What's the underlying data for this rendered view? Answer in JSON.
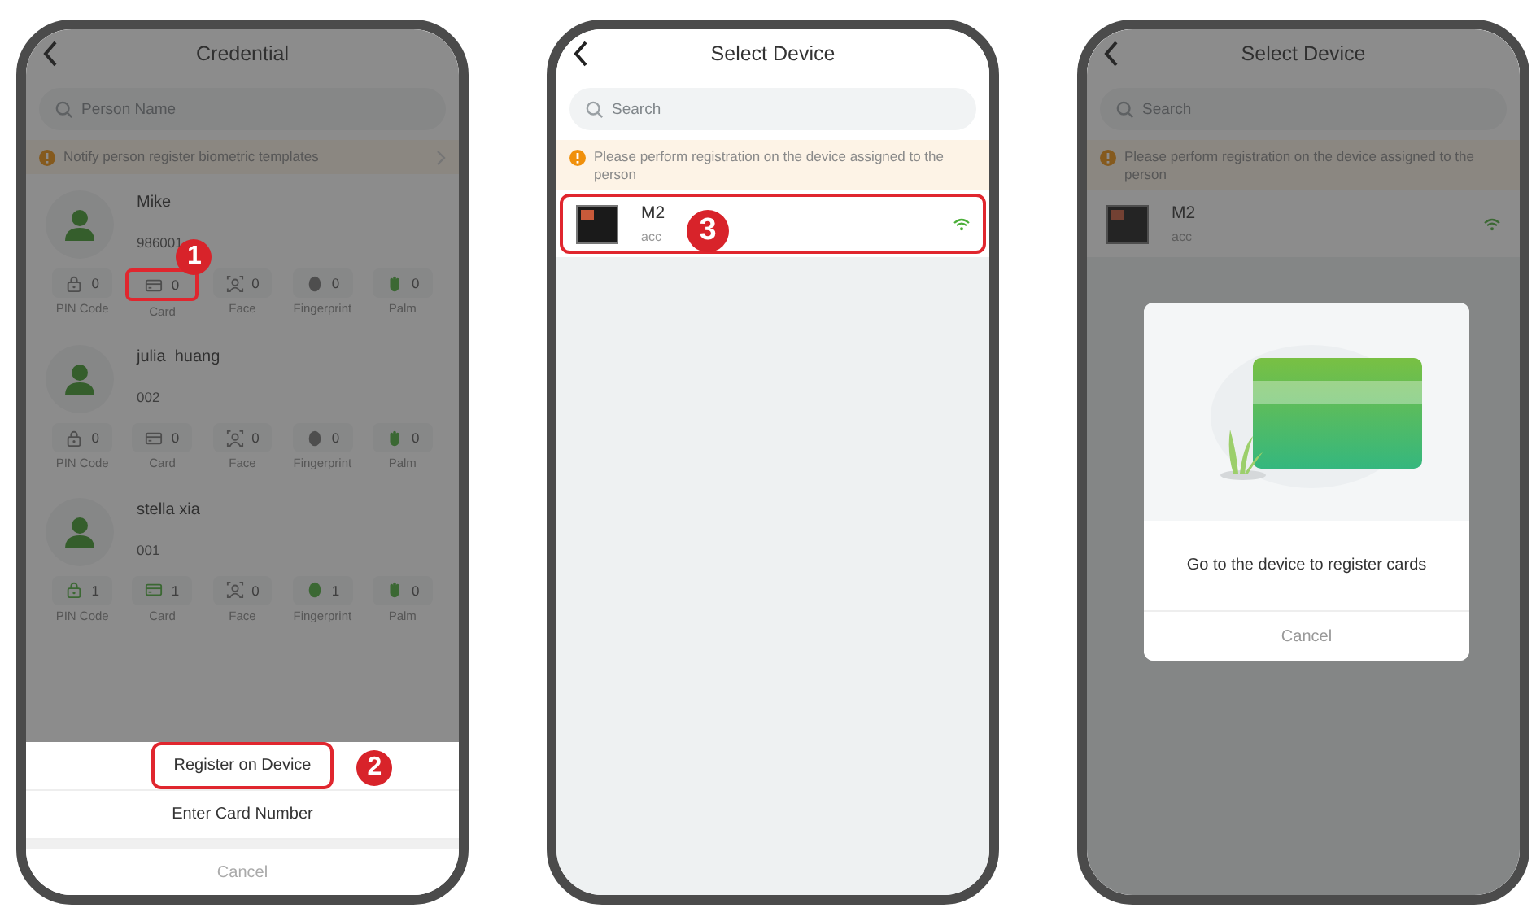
{
  "screens": [
    {
      "kind": "credential",
      "title": "Credential",
      "search": {
        "placeholder": "Person Name"
      },
      "notice": "Notify person register biometric templates",
      "dimmed": true,
      "persons": [
        {
          "name": "Mike",
          "id": "986001",
          "stats": [
            {
              "kind": "pin",
              "label": "PIN Code",
              "count": "0",
              "registered": false,
              "highlighted": false
            },
            {
              "kind": "card",
              "label": "Card",
              "count": "0",
              "registered": false,
              "highlighted": true,
              "step": "1"
            },
            {
              "kind": "face",
              "label": "Face",
              "count": "0",
              "registered": false,
              "highlighted": false
            },
            {
              "kind": "fingerprint",
              "label": "Fingerprint",
              "count": "0",
              "registered": false,
              "highlighted": false
            },
            {
              "kind": "palm",
              "label": "Palm",
              "count": "0",
              "registered": true,
              "highlighted": false
            }
          ]
        },
        {
          "name": "julia  huang",
          "id": "002",
          "stats": [
            {
              "kind": "pin",
              "label": "PIN Code",
              "count": "0",
              "registered": false,
              "highlighted": false
            },
            {
              "kind": "card",
              "label": "Card",
              "count": "0",
              "registered": false,
              "highlighted": false
            },
            {
              "kind": "face",
              "label": "Face",
              "count": "0",
              "registered": false,
              "highlighted": false
            },
            {
              "kind": "fingerprint",
              "label": "Fingerprint",
              "count": "0",
              "registered": false,
              "highlighted": false
            },
            {
              "kind": "palm",
              "label": "Palm",
              "count": "0",
              "registered": true,
              "highlighted": false
            }
          ]
        },
        {
          "name": "stella xia",
          "id": "001",
          "stats": [
            {
              "kind": "pin",
              "label": "PIN Code",
              "count": "1",
              "registered": true,
              "highlighted": false
            },
            {
              "kind": "card",
              "label": "Card",
              "count": "1",
              "registered": true,
              "highlighted": false
            },
            {
              "kind": "face",
              "label": "Face",
              "count": "0",
              "registered": false,
              "highlighted": false
            },
            {
              "kind": "fingerprint",
              "label": "Fingerprint",
              "count": "1",
              "registered": true,
              "highlighted": false
            },
            {
              "kind": "palm",
              "label": "Palm",
              "count": "0",
              "registered": true,
              "highlighted": false
            }
          ]
        }
      ],
      "sheet": {
        "options": [
          {
            "label": "Register on Device",
            "highlighted": true,
            "step": "2"
          },
          {
            "label": "Enter Card Number",
            "highlighted": false
          }
        ],
        "cancel": "Cancel"
      }
    },
    {
      "kind": "device_select",
      "title": "Select Device",
      "search": {
        "placeholder": "Search"
      },
      "notice": "Please perform registration on the device assigned to the person",
      "dimmed": false,
      "devices": [
        {
          "name": "M2",
          "type": "acc",
          "online": true,
          "highlighted": true,
          "step": "3"
        }
      ]
    },
    {
      "kind": "device_select",
      "title": "Select Device",
      "search": {
        "placeholder": "Search"
      },
      "notice": "Please perform registration on the device assigned to the person",
      "dimmed": true,
      "devices": [
        {
          "name": "M2",
          "type": "acc",
          "online": true,
          "highlighted": false
        }
      ],
      "dialog": {
        "message": "Go to the device to register cards",
        "cancel": "Cancel"
      }
    }
  ]
}
